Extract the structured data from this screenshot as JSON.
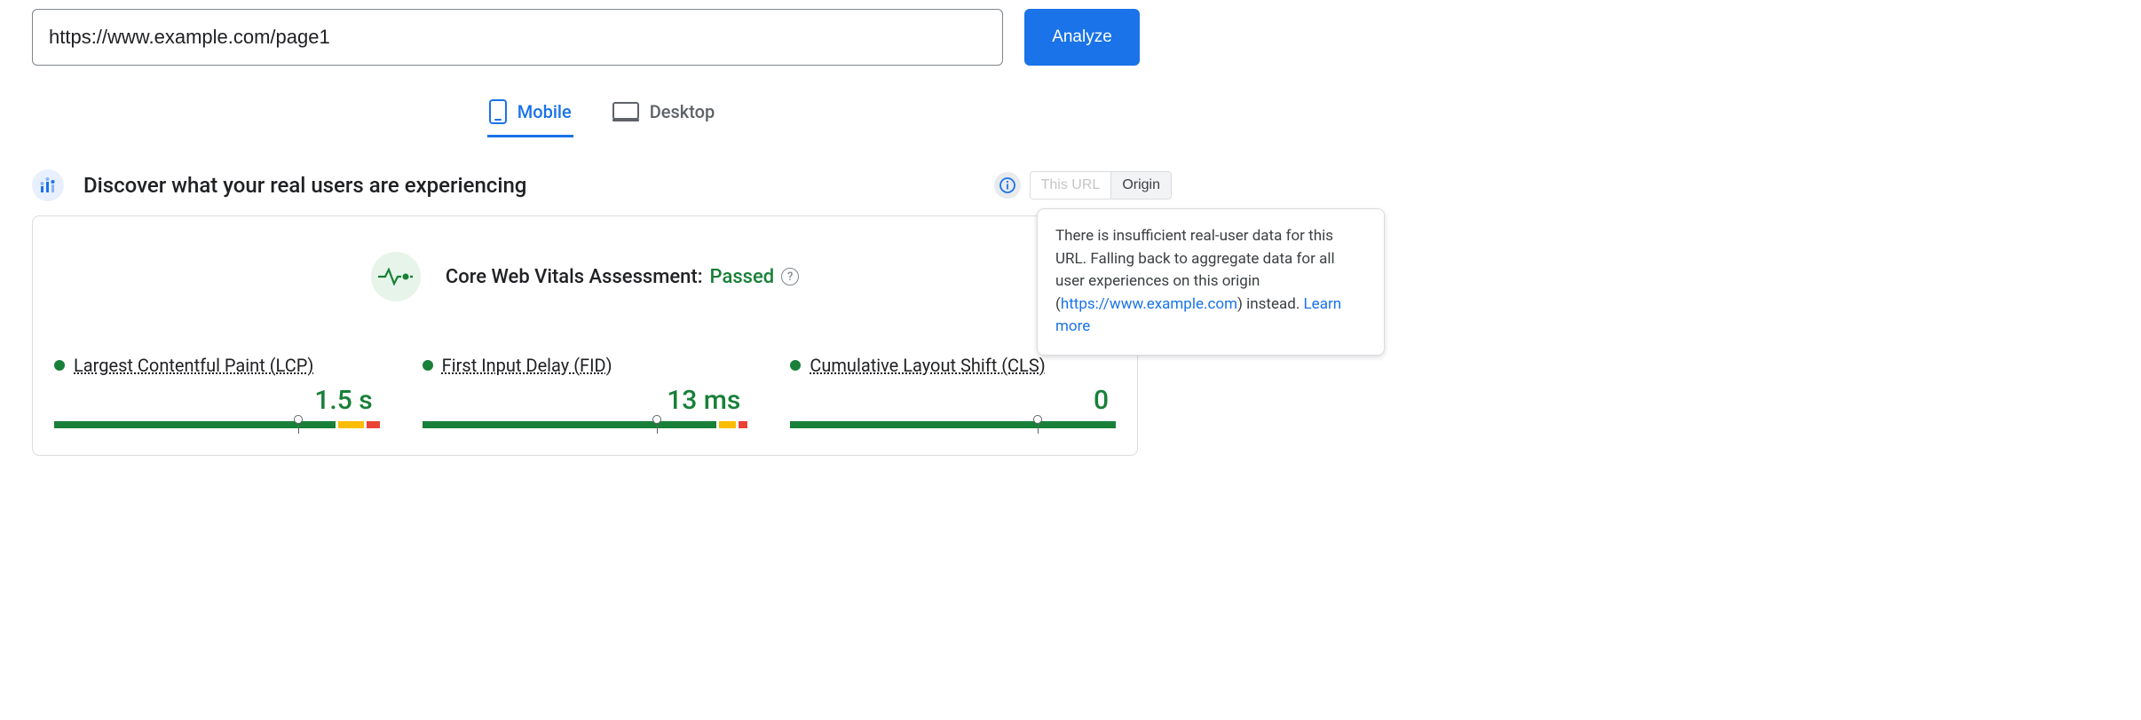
{
  "url_input": {
    "value": "https://www.example.com/page1"
  },
  "analyze_label": "Analyze",
  "tabs": {
    "mobile": "Mobile",
    "desktop": "Desktop"
  },
  "section_title": "Discover what your real users are experiencing",
  "scope": {
    "this_url": "This URL",
    "origin": "Origin"
  },
  "tooltip": {
    "text_before": "There is insufficient real-user data for this URL. Falling back to aggregate data for all user experiences on this origin (",
    "url": "https://www.example.com",
    "text_after": ") instead. ",
    "learn_more": "Learn more"
  },
  "assessment": {
    "label": "Core Web Vitals Assessment: ",
    "status": "Passed"
  },
  "metrics": {
    "lcp": {
      "name": "Largest Contentful Paint (LCP)",
      "value": "1.5 s"
    },
    "fid": {
      "name": "First Input Delay (FID)",
      "value": "13 ms"
    },
    "cls": {
      "name": "Cumulative Layout Shift (CLS)",
      "value": "0"
    }
  }
}
